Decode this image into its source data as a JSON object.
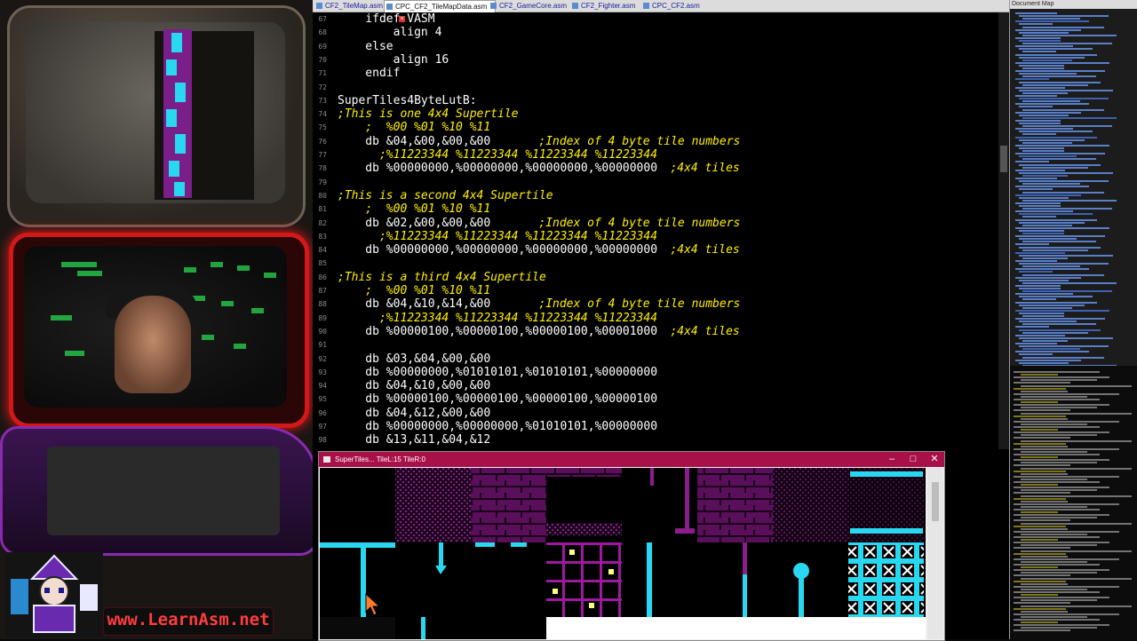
{
  "stream": {
    "website": "www.LearnAsm.net"
  },
  "tabs": [
    {
      "label": "CF2_TileMap.asm",
      "active": false
    },
    {
      "label": "CPC_CF2_TileMapData.asm",
      "active": true
    },
    {
      "label": "CF2_GameCore.asm",
      "active": false
    },
    {
      "label": "CF2_Fighter.asm",
      "active": false
    },
    {
      "label": "CPC_CF2.asm",
      "active": false
    }
  ],
  "code_lines": [
    {
      "n": "67",
      "code": "    ifdef VASM",
      "comment": ""
    },
    {
      "n": "68",
      "code": "        align 4",
      "comment": ""
    },
    {
      "n": "69",
      "code": "    else",
      "comment": ""
    },
    {
      "n": "70",
      "code": "        align 16",
      "comment": ""
    },
    {
      "n": "71",
      "code": "    endif",
      "comment": ""
    },
    {
      "n": "72",
      "code": "",
      "comment": ""
    },
    {
      "n": "73",
      "code": "SuperTiles4ByteLutB:",
      "comment": ""
    },
    {
      "n": "74",
      "code": "",
      "comment": ";This is one 4x4 Supertile"
    },
    {
      "n": "75",
      "code": "",
      "comment": "    ;  %00 %01 %10 %11"
    },
    {
      "n": "76",
      "code": "    db &04,&00,&00,&00",
      "comment": "       ;Index of 4 byte tile numbers"
    },
    {
      "n": "77",
      "code": "",
      "comment": "      ;%11223344 %11223344 %11223344 %11223344"
    },
    {
      "n": "78",
      "code": "    db %00000000,%00000000,%00000000,%00000000",
      "comment": "  ;4x4 tiles"
    },
    {
      "n": "79",
      "code": "",
      "comment": ""
    },
    {
      "n": "80",
      "code": "",
      "comment": ";This is a second 4x4 Supertile"
    },
    {
      "n": "81",
      "code": "",
      "comment": "    ;  %00 %01 %10 %11"
    },
    {
      "n": "82",
      "code": "    db &02,&00,&00,&00",
      "comment": "       ;Index of 4 byte tile numbers"
    },
    {
      "n": "83",
      "code": "",
      "comment": "      ;%11223344 %11223344 %11223344 %11223344"
    },
    {
      "n": "84",
      "code": "    db %00000000,%00000000,%00000000,%00000000",
      "comment": "  ;4x4 tiles"
    },
    {
      "n": "85",
      "code": "",
      "comment": ""
    },
    {
      "n": "86",
      "code": "",
      "comment": ";This is a third 4x4 Supertile"
    },
    {
      "n": "87",
      "code": "",
      "comment": "    ;  %00 %01 %10 %11"
    },
    {
      "n": "88",
      "code": "    db &04,&10,&14,&00",
      "comment": "       ;Index of 4 byte tile numbers"
    },
    {
      "n": "89",
      "code": "",
      "comment": "      ;%11223344 %11223344 %11223344 %11223344"
    },
    {
      "n": "90",
      "code": "    db %00000100,%00000100,%00000100,%00001000",
      "comment": "  ;4x4 tiles"
    },
    {
      "n": "91",
      "code": "",
      "comment": ""
    },
    {
      "n": "92",
      "code": "    db &03,&04,&00,&00",
      "comment": ""
    },
    {
      "n": "93",
      "code": "    db %00000000,%01010101,%01010101,%00000000",
      "comment": ""
    },
    {
      "n": "94",
      "code": "    db &04,&10,&00,&00",
      "comment": ""
    },
    {
      "n": "95",
      "code": "    db %00000100,%00000100,%00000100,%00000100",
      "comment": ""
    },
    {
      "n": "96",
      "code": "    db &04,&12,&00,&00",
      "comment": ""
    },
    {
      "n": "97",
      "code": "    db %00000000,%00000000,%01010101,%00000000",
      "comment": ""
    },
    {
      "n": "98",
      "code": "    db &13,&11,&04,&12",
      "comment": ""
    }
  ],
  "tile_viewer": {
    "title": "SuperTiles... TileL:15 TileR:0",
    "minimize": "–",
    "maximize": "□",
    "close": "✕"
  },
  "right_pane": {
    "title": "Document Map"
  },
  "colors": {
    "comment": "#fff000",
    "code": "#ffffff",
    "tile_cyan": "#28d8f0",
    "tile_magenta": "#8a1e8a",
    "viewer_titlebar": "#a8104a"
  },
  "icons": [
    "file-icon",
    "close-icon",
    "mouse-cursor-icon",
    "minimize-icon",
    "maximize-icon"
  ]
}
